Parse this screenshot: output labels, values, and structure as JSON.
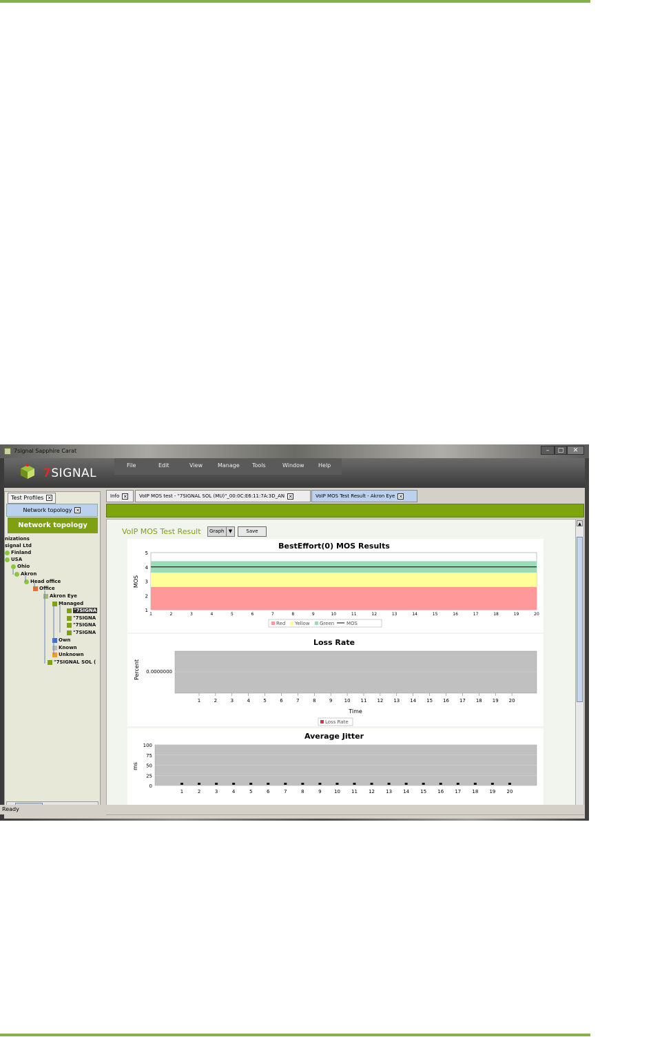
{
  "window": {
    "title": "7signal Sapphire Carat",
    "min_icon": "minimize-icon",
    "max_icon": "maximize-icon",
    "close_icon": "close-icon"
  },
  "header": {
    "logo_seven": "7",
    "logo_text": "SIGNAL",
    "menu": [
      "File",
      "Edit",
      "View",
      "Manage",
      "Tools",
      "Window",
      "Help"
    ]
  },
  "left_panel": {
    "tab_label": "Test Profiles",
    "subtab_label": "Network topology",
    "button_label": "Network topology",
    "tree": [
      "nizations",
      "signal Ltd",
      "Finland",
      "USA",
      "Ohio",
      "Akron",
      "Head office",
      "Office",
      "Akron Eye",
      "Managed",
      "\"7SIGNA",
      "\"7SIGNA",
      "\"7SIGNA",
      "\"7SIGNA",
      "Own",
      "Known",
      "Unknown",
      "\"7SIGNAL SOL ("
    ]
  },
  "tabs": [
    "Info",
    "VoIP MOS test - \"7SIGNAL SOL (MU)\"_00:0C:E6:11:7A:3D_AN",
    "VoIP MOS Test Result - Akron Eye"
  ],
  "content": {
    "title": "VoIP MOS Test Result",
    "view_select": "Graph",
    "save_label": "Save"
  },
  "status": "Ready",
  "colors": {
    "accent_green": "#7ea011",
    "band_red": "#ff9999",
    "band_yellow": "#ffff99",
    "band_green": "#99dcb8",
    "plot_grey": "#c0c0c0"
  },
  "chart_data": [
    {
      "type": "line",
      "title": "BestEffort(0) MOS Results",
      "xlabel": "",
      "ylabel": "MOS",
      "x": [
        1,
        2,
        3,
        4,
        5,
        6,
        7,
        8,
        9,
        10,
        11,
        12,
        13,
        14,
        15,
        16,
        17,
        18,
        19,
        20
      ],
      "ylim": [
        1,
        5
      ],
      "yticks": [
        1,
        2,
        3,
        4,
        5
      ],
      "bands": [
        {
          "name": "Red",
          "from": 1,
          "to": 2.6
        },
        {
          "name": "Yellow",
          "from": 2.6,
          "to": 3.6
        },
        {
          "name": "Green",
          "from": 3.6,
          "to": 4.4
        }
      ],
      "series": [
        {
          "name": "MOS",
          "values": [
            4.0,
            4.0,
            4.0,
            4.0,
            4.0,
            4.0,
            4.0,
            4.0,
            4.0,
            4.0,
            4.0,
            4.0,
            4.0,
            4.0,
            4.0,
            4.0,
            4.0,
            4.0,
            4.0,
            4.0
          ]
        }
      ],
      "legend": [
        "Red",
        "Yellow",
        "Green",
        "MOS"
      ],
      "legend_position": "bottom"
    },
    {
      "type": "line",
      "title": "Loss Rate",
      "xlabel": "Time",
      "ylabel": "Percent",
      "x": [
        1,
        2,
        3,
        4,
        5,
        6,
        7,
        8,
        9,
        10,
        11,
        12,
        13,
        14,
        15,
        16,
        17,
        18,
        19,
        20
      ],
      "yticks": [
        "0.0000000"
      ],
      "series": [
        {
          "name": "Loss Rate",
          "values": [
            0,
            0,
            0,
            0,
            0,
            0,
            0,
            0,
            0,
            0,
            0,
            0,
            0,
            0,
            0,
            0,
            0,
            0,
            0,
            0
          ]
        }
      ],
      "legend": [
        "Loss Rate"
      ],
      "legend_position": "bottom"
    },
    {
      "type": "line",
      "title": "Average Jitter",
      "xlabel": "",
      "ylabel": "ms",
      "x": [
        1,
        2,
        3,
        4,
        5,
        6,
        7,
        8,
        9,
        10,
        11,
        12,
        13,
        14,
        15,
        16,
        17,
        18,
        19,
        20
      ],
      "ylim": [
        0,
        100
      ],
      "yticks": [
        0,
        25,
        50,
        75,
        100
      ],
      "series": [
        {
          "name": "",
          "values": [
            0,
            0,
            0,
            0,
            0,
            0,
            0,
            0,
            0,
            0,
            0,
            0,
            0,
            0,
            0,
            0,
            0,
            0,
            0,
            0
          ]
        }
      ]
    }
  ]
}
